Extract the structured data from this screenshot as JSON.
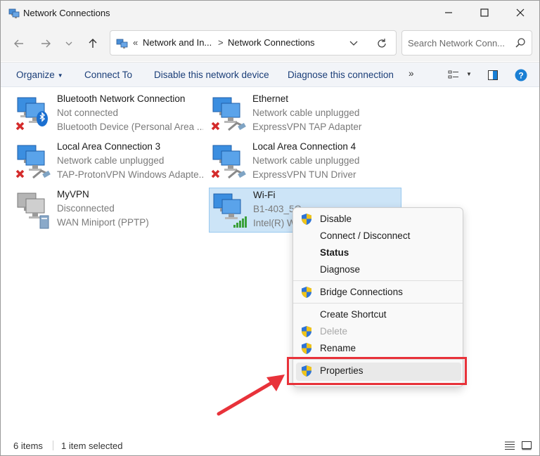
{
  "window": {
    "title": "Network Connections"
  },
  "address": {
    "prefix": "«",
    "crumbs": [
      {
        "label": "Network and In..."
      },
      {
        "label": "Network Connections"
      }
    ],
    "separator": ">"
  },
  "search": {
    "placeholder": "Search Network Conn..."
  },
  "toolbar": {
    "organize": "Organize",
    "connect_to": "Connect To",
    "disable_device": "Disable this network device",
    "diagnose": "Diagnose this connection",
    "more": "»"
  },
  "connections": [
    {
      "name": "Bluetooth Network Connection",
      "status": "Not connected",
      "device": "Bluetooth Device (Personal Area ..."
    },
    {
      "name": "Ethernet",
      "status": "Network cable unplugged",
      "device": "ExpressVPN TAP Adapter"
    },
    {
      "name": "Local Area Connection 3",
      "status": "Network cable unplugged",
      "device": "TAP-ProtonVPN Windows Adapte..."
    },
    {
      "name": "Local Area Connection 4",
      "status": "Network cable unplugged",
      "device": "ExpressVPN TUN Driver"
    },
    {
      "name": "MyVPN",
      "status": "Disconnected",
      "device": "WAN Miniport (PPTP)"
    },
    {
      "name": "Wi-Fi",
      "status": "B1-403_5G",
      "device": "Intel(R) Wi-Fi"
    }
  ],
  "context_menu": {
    "disable": "Disable",
    "connect_disconnect": "Connect / Disconnect",
    "status": "Status",
    "diagnose": "Diagnose",
    "bridge": "Bridge Connections",
    "create_shortcut": "Create Shortcut",
    "delete": "Delete",
    "rename": "Rename",
    "properties": "Properties"
  },
  "statusbar": {
    "count": "6 items",
    "selected": "1 item selected"
  },
  "colors": {
    "accent": "#1b3e78",
    "selection": "#cce4f7",
    "highlight_box": "#e8323a",
    "help": "#1a7fd4"
  }
}
